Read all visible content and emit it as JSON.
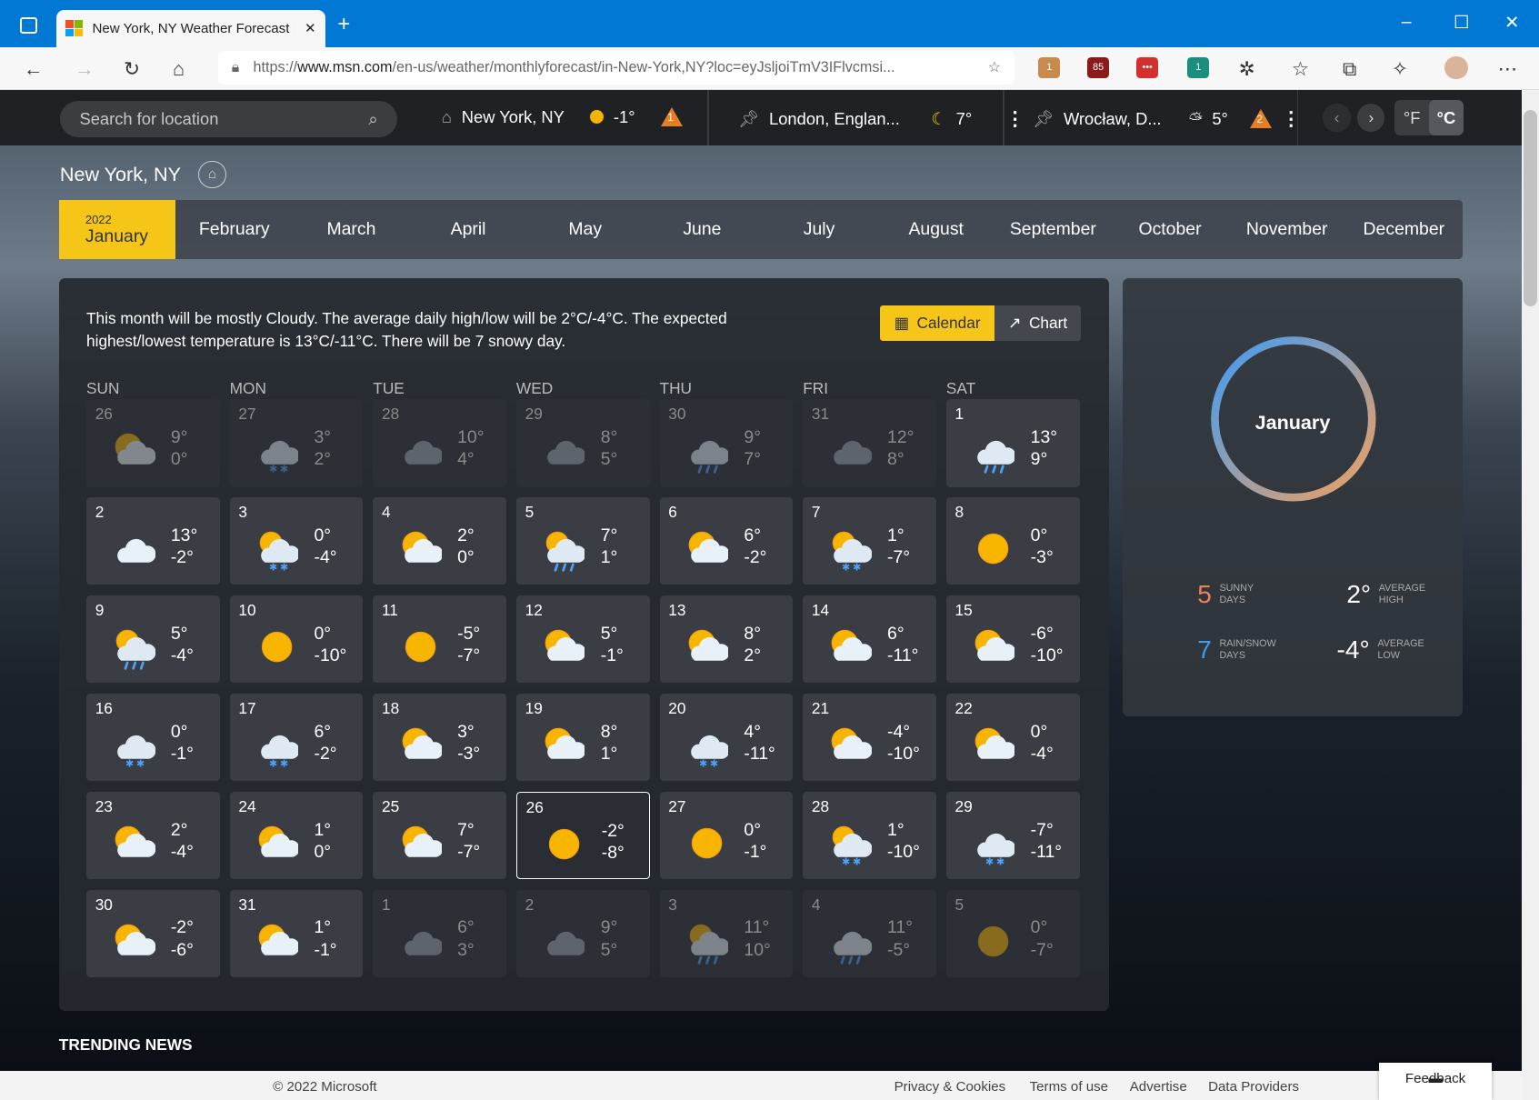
{
  "browser": {
    "tab_title": "New York, NY Weather Forecast |",
    "url_prefix": "https://",
    "url_host": "www.msn.com",
    "url_rest": "/en-us/weather/monthlyforecast/in-New-York,NY?loc=eyJsljoiTmV3IFlvcmsi...",
    "ext_badges": [
      "1",
      "85",
      "1"
    ]
  },
  "weather_bar": {
    "search_placeholder": "Search for location",
    "locations": [
      {
        "name": "New York, NY",
        "temp": "-1°",
        "alerts": "1",
        "icon": "sun-icon"
      },
      {
        "name": "London, Englan...",
        "temp": "7°",
        "icon": "moon-icon"
      },
      {
        "name": "Wrocław, D...",
        "temp": "5°",
        "alerts": "2",
        "icon": "partly-cloudy-icon"
      }
    ],
    "unit_f": "°F",
    "unit_c": "°C",
    "selected_unit": "°C"
  },
  "city": "New York, NY",
  "months": {
    "year": "2022",
    "items": [
      "January",
      "February",
      "March",
      "April",
      "May",
      "June",
      "July",
      "August",
      "September",
      "October",
      "November",
      "December"
    ],
    "selected": "January"
  },
  "calendar": {
    "description": "This month will be mostly Cloudy. The average daily high/low will be 2°C/-4°C. The expected highest/lowest temperature is 13°C/-11°C. There will be 7 snowy day.",
    "view_calendar": "Calendar",
    "view_chart": "Chart",
    "selected_view": "Calendar",
    "weekdays": [
      "SUN",
      "MON",
      "TUE",
      "WED",
      "THU",
      "FRI",
      "SAT"
    ],
    "days": [
      {
        "d": "26",
        "hi": "9°",
        "lo": "0°",
        "icon": "partly-sunny",
        "dim": true
      },
      {
        "d": "27",
        "hi": "3°",
        "lo": "2°",
        "icon": "snow",
        "dim": true
      },
      {
        "d": "28",
        "hi": "10°",
        "lo": "4°",
        "icon": "cloudy",
        "dim": true
      },
      {
        "d": "29",
        "hi": "8°",
        "lo": "5°",
        "icon": "cloudy",
        "dim": true
      },
      {
        "d": "30",
        "hi": "9°",
        "lo": "7°",
        "icon": "rain",
        "dim": true
      },
      {
        "d": "31",
        "hi": "12°",
        "lo": "8°",
        "icon": "cloudy",
        "dim": true
      },
      {
        "d": "1",
        "hi": "13°",
        "lo": "9°",
        "icon": "rain"
      },
      {
        "d": "2",
        "hi": "13°",
        "lo": "-2°",
        "icon": "light-cloud"
      },
      {
        "d": "3",
        "hi": "0°",
        "lo": "-4°",
        "icon": "sun-snow"
      },
      {
        "d": "4",
        "hi": "2°",
        "lo": "0°",
        "icon": "partly-sunny"
      },
      {
        "d": "5",
        "hi": "7°",
        "lo": "1°",
        "icon": "sun-rain"
      },
      {
        "d": "6",
        "hi": "6°",
        "lo": "-2°",
        "icon": "partly-sunny"
      },
      {
        "d": "7",
        "hi": "1°",
        "lo": "-7°",
        "icon": "sun-snow"
      },
      {
        "d": "8",
        "hi": "0°",
        "lo": "-3°",
        "icon": "sun"
      },
      {
        "d": "9",
        "hi": "5°",
        "lo": "-4°",
        "icon": "sun-rain"
      },
      {
        "d": "10",
        "hi": "0°",
        "lo": "-10°",
        "icon": "sun"
      },
      {
        "d": "11",
        "hi": "-5°",
        "lo": "-7°",
        "icon": "sun"
      },
      {
        "d": "12",
        "hi": "5°",
        "lo": "-1°",
        "icon": "partly-sunny"
      },
      {
        "d": "13",
        "hi": "8°",
        "lo": "2°",
        "icon": "partly-sunny"
      },
      {
        "d": "14",
        "hi": "6°",
        "lo": "-11°",
        "icon": "partly-sunny"
      },
      {
        "d": "15",
        "hi": "-6°",
        "lo": "-10°",
        "icon": "partly-sunny"
      },
      {
        "d": "16",
        "hi": "0°",
        "lo": "-1°",
        "icon": "snow"
      },
      {
        "d": "17",
        "hi": "6°",
        "lo": "-2°",
        "icon": "snow"
      },
      {
        "d": "18",
        "hi": "3°",
        "lo": "-3°",
        "icon": "partly-sunny"
      },
      {
        "d": "19",
        "hi": "8°",
        "lo": "1°",
        "icon": "partly-sunny"
      },
      {
        "d": "20",
        "hi": "4°",
        "lo": "-11°",
        "icon": "snow"
      },
      {
        "d": "21",
        "hi": "-4°",
        "lo": "-10°",
        "icon": "partly-sunny"
      },
      {
        "d": "22",
        "hi": "0°",
        "lo": "-4°",
        "icon": "partly-sunny"
      },
      {
        "d": "23",
        "hi": "2°",
        "lo": "-4°",
        "icon": "partly-sunny"
      },
      {
        "d": "24",
        "hi": "1°",
        "lo": "0°",
        "icon": "partly-sunny"
      },
      {
        "d": "25",
        "hi": "7°",
        "lo": "-7°",
        "icon": "partly-sunny"
      },
      {
        "d": "26",
        "hi": "-2°",
        "lo": "-8°",
        "icon": "sun",
        "selected": true
      },
      {
        "d": "27",
        "hi": "0°",
        "lo": "-1°",
        "icon": "sun"
      },
      {
        "d": "28",
        "hi": "1°",
        "lo": "-10°",
        "icon": "sun-snow"
      },
      {
        "d": "29",
        "hi": "-7°",
        "lo": "-11°",
        "icon": "snow"
      },
      {
        "d": "30",
        "hi": "-2°",
        "lo": "-6°",
        "icon": "partly-sunny"
      },
      {
        "d": "31",
        "hi": "1°",
        "lo": "-1°",
        "icon": "partly-sunny"
      },
      {
        "d": "1",
        "hi": "6°",
        "lo": "3°",
        "icon": "cloudy",
        "dim": true
      },
      {
        "d": "2",
        "hi": "9°",
        "lo": "5°",
        "icon": "cloudy",
        "dim": true
      },
      {
        "d": "3",
        "hi": "11°",
        "lo": "10°",
        "icon": "sun-rain",
        "dim": true
      },
      {
        "d": "4",
        "hi": "11°",
        "lo": "-5°",
        "icon": "rain",
        "dim": true
      },
      {
        "d": "5",
        "hi": "0°",
        "lo": "-7°",
        "icon": "sun",
        "dim": true
      }
    ]
  },
  "summary": {
    "ring_label": "January",
    "sunny_days": "5",
    "sunny_label_1": "SUNNY",
    "sunny_label_2": "DAYS",
    "rain_days": "7",
    "rain_label_1": "RAIN/SNOW",
    "rain_label_2": "DAYS",
    "avg_high": "2°",
    "avg_high_label_1": "AVERAGE",
    "avg_high_label_2": "HIGH",
    "avg_low": "-4°",
    "avg_low_label_1": "AVERAGE",
    "avg_low_label_2": "LOW",
    "colors": {
      "sunny": "#f07f5a",
      "rain": "#3f9cf5",
      "ring_start": "#3f9cf5",
      "ring_end": "#f0a060"
    }
  },
  "trending": "TRENDING NEWS",
  "footer": {
    "copyright": "© 2022 Microsoft",
    "links": [
      "Privacy & Cookies",
      "Terms of use",
      "Advertise",
      "Data Providers"
    ],
    "feedback": "Feedback"
  }
}
